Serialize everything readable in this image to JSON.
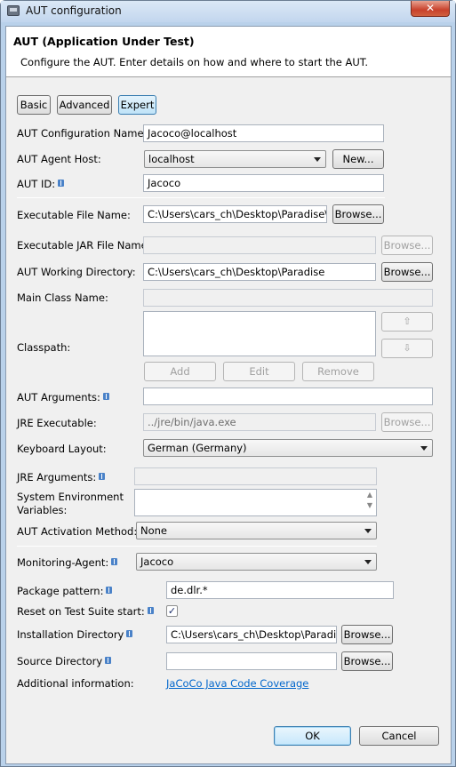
{
  "window": {
    "title": "AUT configuration",
    "close_label": "✕"
  },
  "header": {
    "title": "AUT (Application Under Test)",
    "description": "Configure the AUT. Enter details on how and where to start the AUT."
  },
  "tabs": {
    "basic": "Basic",
    "advanced": "Advanced",
    "expert": "Expert",
    "selected": "Expert"
  },
  "fields": {
    "config_name": {
      "label": "AUT Configuration Name:",
      "value": "Jacoco@localhost"
    },
    "agent_host": {
      "label": "AUT Agent Host:",
      "value": "localhost",
      "new_button": "New..."
    },
    "aut_id": {
      "label": "AUT ID:",
      "value": "Jacoco"
    },
    "executable": {
      "label": "Executable File Name:",
      "value": "C:\\Users\\cars_ch\\Desktop\\Paradise\\P",
      "browse": "Browse..."
    },
    "jar_file": {
      "label": "Executable JAR File Name:",
      "value": "",
      "browse": "Browse..."
    },
    "working_dir": {
      "label": "AUT Working Directory:",
      "value": "C:\\Users\\cars_ch\\Desktop\\Paradise",
      "browse": "Browse..."
    },
    "main_class": {
      "label": "Main Class Name:",
      "value": ""
    },
    "classpath": {
      "label": "Classpath:",
      "up": "⇧",
      "down": "⇩",
      "add": "Add",
      "edit": "Edit",
      "remove": "Remove"
    },
    "aut_arguments": {
      "label": "AUT Arguments:",
      "value": ""
    },
    "jre_executable": {
      "label": "JRE Executable:",
      "value": "../jre/bin/java.exe",
      "browse": "Browse..."
    },
    "keyboard_layout": {
      "label": "Keyboard Layout:",
      "value": "German (Germany)"
    },
    "jre_arguments": {
      "label": "JRE Arguments:",
      "value": ""
    },
    "env_vars": {
      "label_line1": "System Environment",
      "label_line2": "Variables:",
      "value": ""
    },
    "activation_method": {
      "label": "AUT Activation Method:",
      "value": "None"
    },
    "monitoring_agent": {
      "label": "Monitoring-Agent:",
      "value": "Jacoco"
    },
    "package_pattern": {
      "label": "Package pattern:",
      "value": "de.dlr.*"
    },
    "reset_on_start": {
      "label": "Reset on Test Suite start:",
      "checked": true,
      "mark": "✓"
    },
    "install_dir": {
      "label": "Installation Directory",
      "value": "C:\\Users\\cars_ch\\Desktop\\Paradise",
      "browse": "Browse..."
    },
    "source_dir": {
      "label": "Source Directory",
      "value": "",
      "browse": "Browse..."
    },
    "additional_info": {
      "label": "Additional information:",
      "link": "JaCoCo Java Code Coverage"
    }
  },
  "footer": {
    "ok": "OK",
    "cancel": "Cancel"
  }
}
